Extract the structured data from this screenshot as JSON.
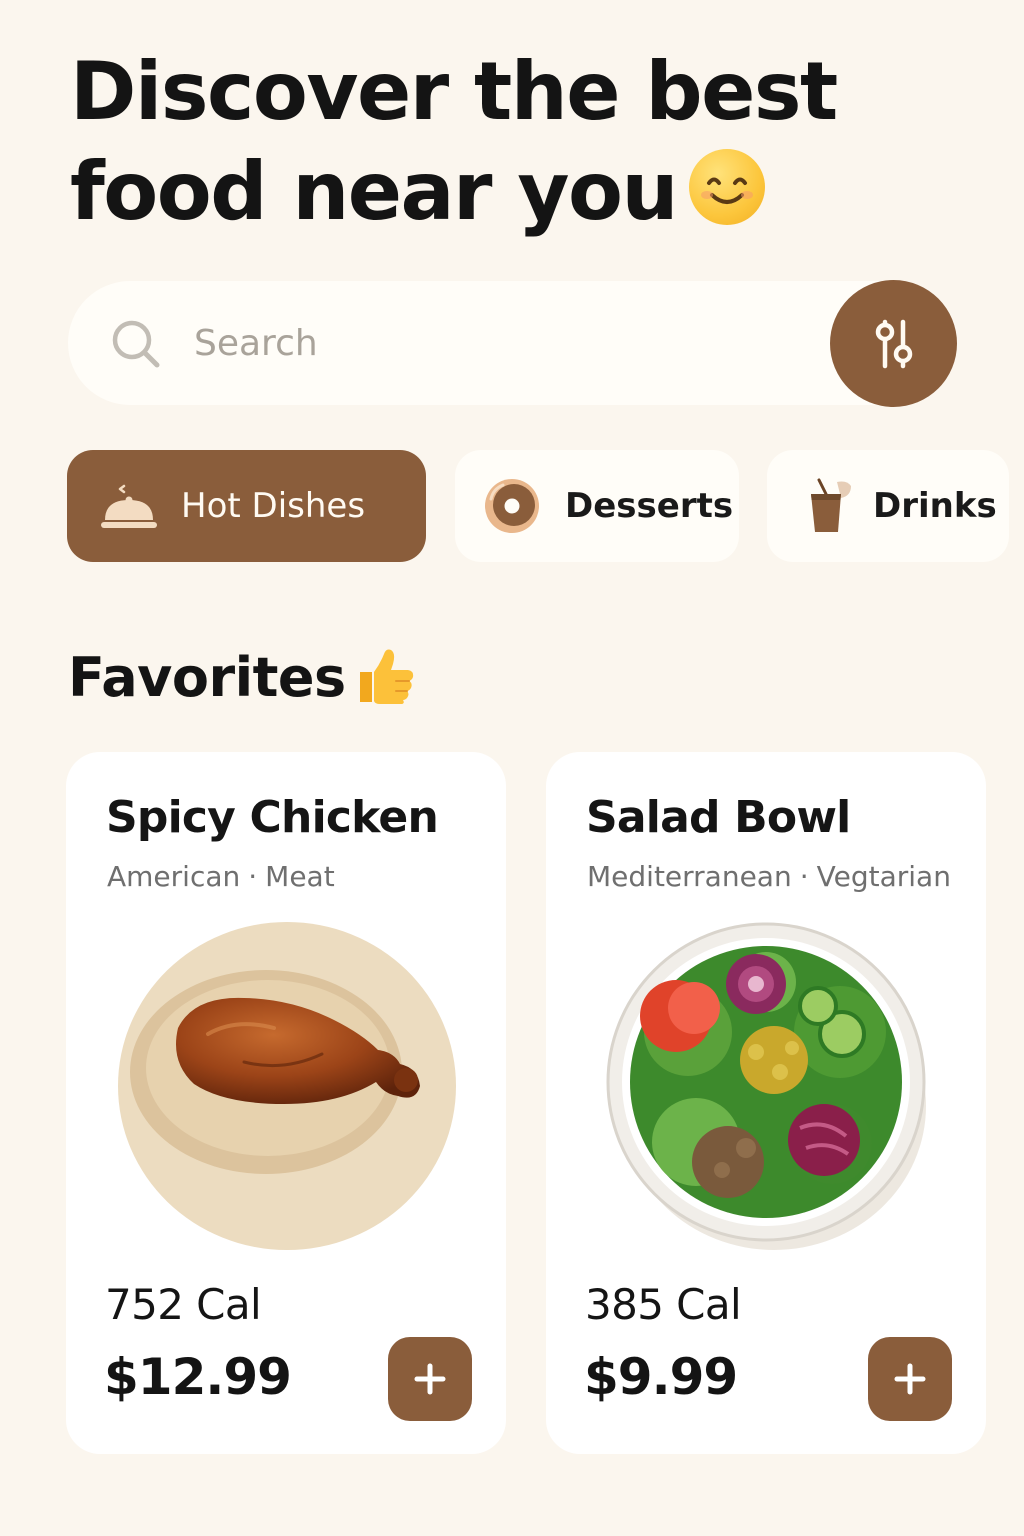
{
  "header": {
    "title_line_1": "Discover the best",
    "title_line_2": "food near you",
    "title_emoji": "smiling-face-icon"
  },
  "search": {
    "placeholder": "Search",
    "value": "",
    "icon": "search-icon",
    "filter_icon": "sliders-icon"
  },
  "categories": [
    {
      "label": "Hot Dishes",
      "icon": "cloche-icon",
      "active": true
    },
    {
      "label": "Desserts",
      "icon": "donut-icon",
      "active": false
    },
    {
      "label": "Drinks",
      "icon": "drink-cup-icon",
      "active": false
    }
  ],
  "favorites": {
    "title": "Favorites",
    "title_emoji": "thumbs-up-icon",
    "items": [
      {
        "name": "Spicy Chicken",
        "cuisine": "American",
        "separator": "·",
        "category": "Meat",
        "calories": "752 Cal",
        "price": "$12.99",
        "image": "roast-chicken-plate"
      },
      {
        "name": "Salad Bowl",
        "cuisine": "Mediterranean",
        "separator": "·",
        "category": "Vegtarian",
        "calories": "385 Cal",
        "price": "$9.99",
        "image": "salad-bowl"
      }
    ]
  },
  "colors": {
    "background": "#fbf6ee",
    "accent": "#8a5d3b",
    "surface": "#ffffff",
    "muted_text": "#6f6f6f"
  }
}
